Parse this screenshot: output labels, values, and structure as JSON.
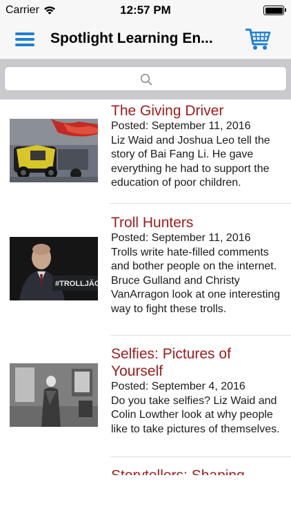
{
  "status_bar": {
    "carrier": "Carrier",
    "time": "12:57 PM"
  },
  "nav": {
    "title": "Spotlight Learning En...",
    "menu_icon": "hamburger-menu-icon",
    "cart_icon": "shopping-cart-icon"
  },
  "search": {
    "icon": "search-icon",
    "placeholder": ""
  },
  "articles": [
    {
      "title": "The Giving Driver",
      "date": "Posted: September 11, 2016",
      "description": "Liz Waid and Joshua Leo tell the story of Bai Fang Li. He gave everything he had to support the education of poor children."
    },
    {
      "title": "Troll Hunters",
      "date": "Posted: September 11, 2016",
      "description": "Trolls write hate-filled comments and bother people on the internet. Bruce Gulland and Christy VanArragon look at one interesting way to fight these trolls.",
      "image_text": "#TROLLJÄGAR"
    },
    {
      "title": "Selfies: Pictures of Yourself",
      "date": "Posted: September 4, 2016",
      "description": "Do you take selfies? Liz Waid and Colin Lowther look at why people like to take pictures of themselves."
    },
    {
      "title": "Storytellers: Shaping"
    }
  ],
  "colors": {
    "accent_blue": "#1e7fd6",
    "title_red": "#9c1b1b",
    "nav_background": "#f7f7f7",
    "search_background": "#c9c9ce"
  }
}
